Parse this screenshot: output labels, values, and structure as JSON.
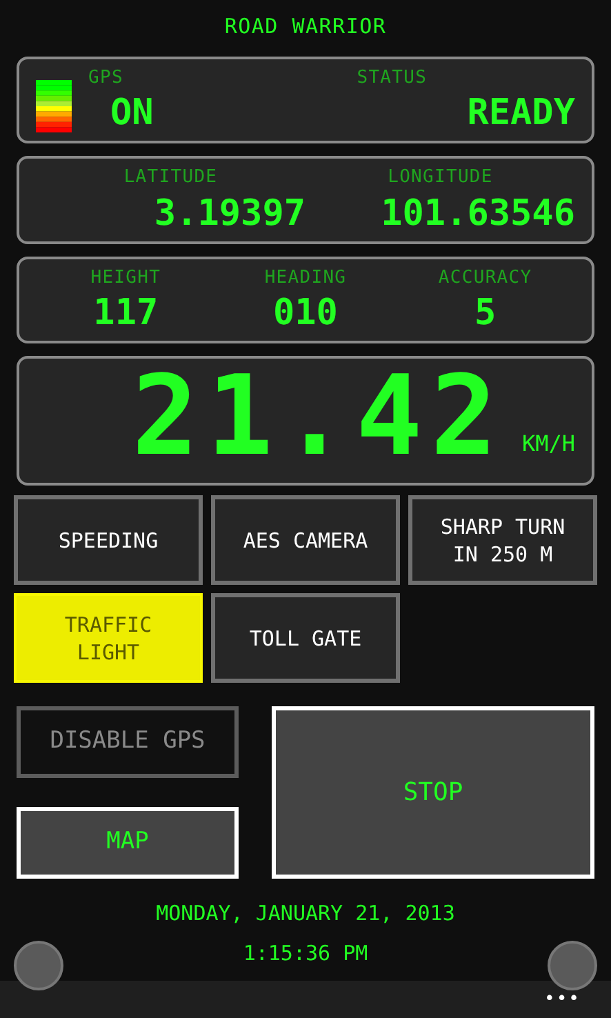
{
  "title": "ROAD WARRIOR",
  "gps": {
    "label": "GPS",
    "value": "ON"
  },
  "status": {
    "label": "STATUS",
    "value": "READY"
  },
  "coords": [
    {
      "label": "LATITUDE",
      "value": "3.19397"
    },
    {
      "label": "LONGITUDE",
      "value": "101.63546"
    }
  ],
  "metrics": [
    {
      "label": "HEIGHT",
      "value": "117"
    },
    {
      "label": "HEADING",
      "value": "010"
    },
    {
      "label": "ACCURACY",
      "value": "5"
    }
  ],
  "speed": {
    "value": "21.42",
    "unit": "KM/H"
  },
  "alerts": [
    {
      "label": "SPEEDING",
      "active": false
    },
    {
      "label": "AES CAMERA",
      "active": false
    },
    {
      "label": "SHARP TURN IN 250 M",
      "active": false
    },
    {
      "label": "TRAFFIC LIGHT",
      "active": true
    },
    {
      "label": "TOLL GATE",
      "active": false
    }
  ],
  "controls": [
    {
      "label": "DISABLE GPS",
      "kind": "dim"
    },
    {
      "label": "MAP",
      "kind": "bright"
    },
    {
      "label": "STOP",
      "kind": "bright"
    }
  ],
  "date": "MONDAY, JANUARY 21, 2013",
  "time": "1:15:36 PM",
  "menu": "•••"
}
